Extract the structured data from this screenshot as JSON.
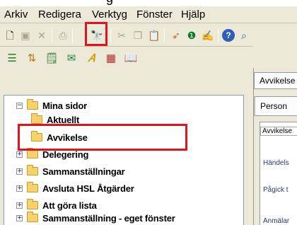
{
  "window": {
    "title_fragment": "g"
  },
  "menu": [
    "Arkiv",
    "Redigera",
    "Verktyg",
    "Fönster",
    "Hjälp"
  ],
  "toolbar1": [
    {
      "icon": "new-document-icon",
      "glyph": "🗋"
    },
    {
      "icon": "save-icon",
      "glyph": "▣"
    },
    {
      "icon": "delete-icon",
      "glyph": "✕"
    },
    {
      "icon": "print-icon",
      "glyph": "⎙"
    },
    {
      "icon": "find-icon",
      "glyph": "🔭"
    },
    {
      "icon": "cut-icon",
      "glyph": "✂"
    },
    {
      "icon": "copy-icon",
      "glyph": "❐"
    },
    {
      "icon": "paste-icon",
      "glyph": "📋"
    },
    {
      "icon": "pin-icon",
      "glyph": "➶"
    },
    {
      "icon": "info-icon",
      "glyph": "❶"
    },
    {
      "icon": "sign-icon",
      "glyph": "✍"
    },
    {
      "icon": "help-icon",
      "glyph": "?"
    },
    {
      "icon": "whats-this-icon",
      "glyph": "⌕"
    }
  ],
  "toolbar2": [
    {
      "icon": "list-icon",
      "glyph": "☰"
    },
    {
      "icon": "sort-icon",
      "glyph": "⇅"
    },
    {
      "icon": "note-icon",
      "glyph": "🗒"
    },
    {
      "icon": "mail-icon",
      "glyph": "✉"
    },
    {
      "icon": "font-icon",
      "glyph": "𝐴"
    },
    {
      "icon": "calendar-icon",
      "glyph": "▦"
    },
    {
      "icon": "book-icon",
      "glyph": "📖"
    }
  ],
  "tree": {
    "root": "Mina sidor",
    "items": [
      "Aktuellt",
      "Avvikelse",
      "Delegering",
      "Sammanställningar",
      "Avsluta HSL Åtgärder",
      "Att göra lista",
      "Sammanställning - eget fönster"
    ]
  },
  "right": {
    "tab_top": "Avvikelse",
    "tab_sub": "Person",
    "inner_tab": "Avvikelse",
    "fields": [
      "Händels",
      "Pågick t",
      "Anmälar"
    ]
  },
  "highlight_color": "#e0141e"
}
